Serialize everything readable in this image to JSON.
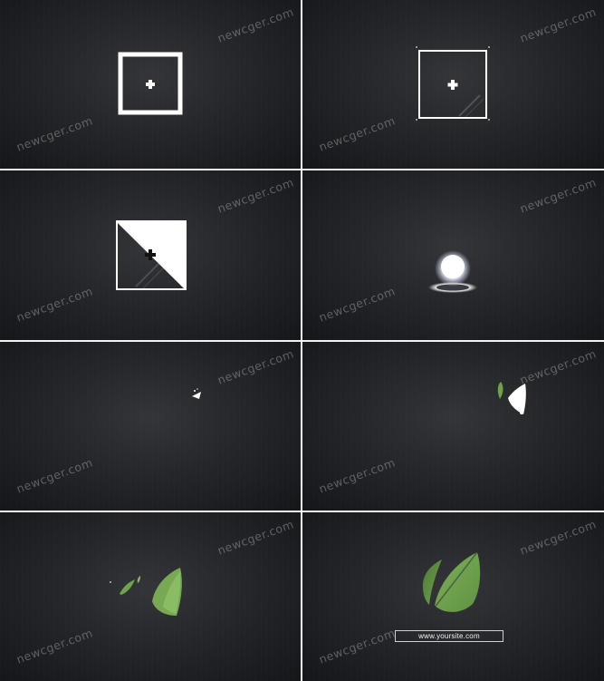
{
  "watermark": "newcger.com",
  "frames": [
    {
      "label": "frame-1-outlined-square"
    },
    {
      "label": "frame-2-thin-square"
    },
    {
      "label": "frame-3-split-square"
    },
    {
      "label": "frame-4-glowing-orb"
    },
    {
      "label": "frame-5-small-shard"
    },
    {
      "label": "frame-6-white-leaf-emerging"
    },
    {
      "label": "frame-7-green-leaf-forming"
    },
    {
      "label": "frame-8-final-logo"
    }
  ],
  "final_logo": {
    "url": "www.yoursite.com",
    "leaf_color": "#6fa24b",
    "leaf_dark": "#4f7a34"
  }
}
